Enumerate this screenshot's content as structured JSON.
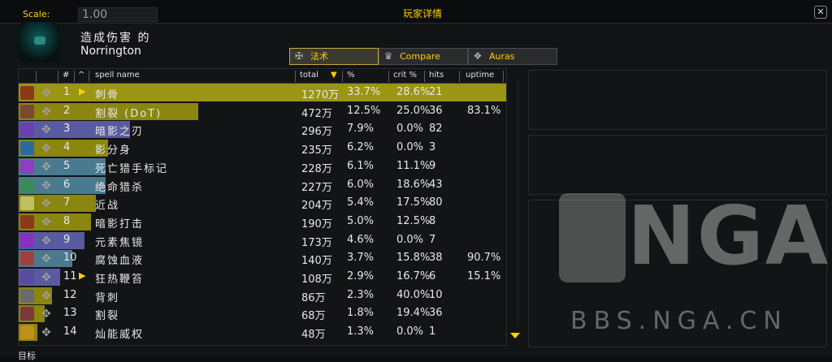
{
  "window": {
    "scale_label": "Scale:",
    "scale_value": "1.00",
    "title": "玩家详情",
    "close": "✕"
  },
  "player": {
    "heading": "造成伤害 的",
    "name": "Norrington"
  },
  "tabs": [
    {
      "label": "法术",
      "icon": "spellbook-icon",
      "active": true
    },
    {
      "label": "Compare",
      "icon": "crown-icon",
      "active": false
    },
    {
      "label": "Auras",
      "icon": "aura-icon",
      "active": false
    }
  ],
  "columns": {
    "index": "#",
    "caret": "^",
    "spell_name": "spell name",
    "total": "total",
    "pct": "%",
    "crit": "crit %",
    "hits": "hits",
    "uptime": "uptime"
  },
  "rows": [
    {
      "n": "1",
      "spell": "刺骨",
      "total": "1270万",
      "pct": "33.7%",
      "crit": "28.6%",
      "hits": "21",
      "uptime": "",
      "arrow": "▶",
      "fill": 1.0,
      "color": "#9a9512",
      "icon": "#8a3a1a"
    },
    {
      "n": "2",
      "spell": "割裂 (DoT)",
      "total": "472万",
      "pct": "12.5%",
      "crit": "25.0%",
      "hits": "36",
      "uptime": "83.1%",
      "arrow": "",
      "fill": 0.37,
      "color": "#8a8610",
      "icon": "#7a4a30"
    },
    {
      "n": "3",
      "spell": "暗影之刃",
      "total": "296万",
      "pct": "7.9%",
      "crit": "0.0%",
      "hits": "82",
      "uptime": "",
      "arrow": "",
      "fill": 0.23,
      "color": "#5a5aa0",
      "icon": "#6a40b0"
    },
    {
      "n": "4",
      "spell": "影分身",
      "total": "235万",
      "pct": "6.2%",
      "crit": "0.0%",
      "hits": "3",
      "uptime": "",
      "arrow": "",
      "fill": 0.185,
      "color": "#8a8610",
      "icon": "#2a6aa0"
    },
    {
      "n": "5",
      "spell": "死亡猎手标记",
      "total": "228万",
      "pct": "6.1%",
      "crit": "11.1%",
      "hits": "9",
      "uptime": "",
      "arrow": "",
      "fill": 0.18,
      "color": "#4a7a90",
      "icon": "#8a40c0"
    },
    {
      "n": "6",
      "spell": "绝命猎杀",
      "total": "227万",
      "pct": "6.0%",
      "crit": "18.6%",
      "hits": "43",
      "uptime": "",
      "arrow": "",
      "fill": 0.179,
      "color": "#4a7a90",
      "icon": "#3a8a5a"
    },
    {
      "n": "7",
      "spell": "近战",
      "total": "204万",
      "pct": "5.4%",
      "crit": "17.5%",
      "hits": "80",
      "uptime": "",
      "arrow": "",
      "fill": 0.16,
      "color": "#8a8610",
      "icon": "#c0c060"
    },
    {
      "n": "8",
      "spell": "暗影打击",
      "total": "190万",
      "pct": "5.0%",
      "crit": "12.5%",
      "hits": "8",
      "uptime": "",
      "arrow": "",
      "fill": 0.15,
      "color": "#8a8610",
      "icon": "#8a3a1a"
    },
    {
      "n": "9",
      "spell": "元素焦镜",
      "total": "173万",
      "pct": "4.6%",
      "crit": "0.0%",
      "hits": "7",
      "uptime": "",
      "arrow": "",
      "fill": 0.136,
      "color": "#5a5aa0",
      "icon": "#8a30c0"
    },
    {
      "n": "10",
      "spell": "腐蚀血液",
      "total": "140万",
      "pct": "3.7%",
      "crit": "15.8%",
      "hits": "38",
      "uptime": "90.7%",
      "arrow": "",
      "fill": 0.11,
      "color": "#4a7a90",
      "icon": "#a04040"
    },
    {
      "n": "11",
      "spell": "狂热鞭笞",
      "total": "108万",
      "pct": "2.9%",
      "crit": "16.7%",
      "hits": "6",
      "uptime": "15.1%",
      "arrow": "▶",
      "fill": 0.085,
      "color": "#5a5aa0",
      "icon": "#5a4aa0"
    },
    {
      "n": "12",
      "spell": "背刺",
      "total": "86万",
      "pct": "2.3%",
      "crit": "40.0%",
      "hits": "10",
      "uptime": "",
      "arrow": "",
      "fill": 0.068,
      "color": "#8a8610",
      "icon": "#6a6a6a"
    },
    {
      "n": "13",
      "spell": "割裂",
      "total": "68万",
      "pct": "1.8%",
      "crit": "19.4%",
      "hits": "36",
      "uptime": "",
      "arrow": "",
      "fill": 0.054,
      "color": "#8a8610",
      "icon": "#7a3a3a"
    },
    {
      "n": "14",
      "spell": "灿能威权",
      "total": "48万",
      "pct": "1.3%",
      "crit": "0.0%",
      "hits": "1",
      "uptime": "",
      "arrow": "",
      "fill": 0.038,
      "color": "#8a8610",
      "icon": "#c0901a"
    }
  ],
  "watermark": {
    "logo": "NGA",
    "url": "BBS.NGA.CN"
  },
  "footer_text": "目标"
}
